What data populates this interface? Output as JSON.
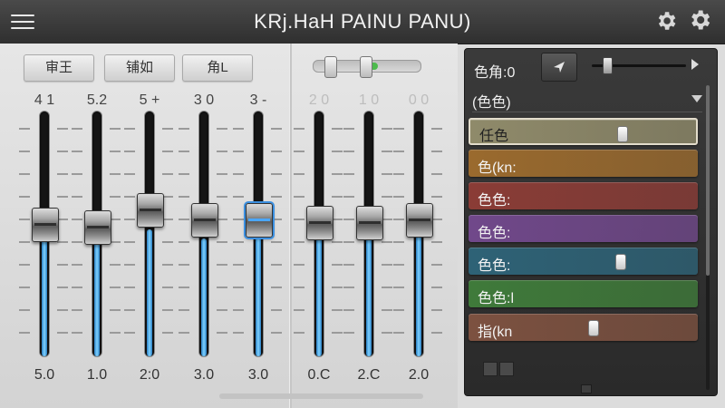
{
  "header": {
    "title": "KRj.HaH PAINU PANU)",
    "icons": [
      "menu-icon",
      "gear-icon",
      "gear-icon"
    ]
  },
  "mixer": {
    "mode_buttons": [
      "审王",
      "铺如",
      "角L"
    ],
    "top_values": [
      "4 1",
      "5.2",
      "5 +",
      "3 0",
      "3 -",
      "2 0",
      "1 0",
      "0 0"
    ],
    "bottom_values": [
      "5.0",
      "1.0",
      "2:0",
      "3.0",
      "3.0",
      "0.C",
      "2.C",
      "2.0"
    ],
    "channels": [
      {
        "level": 0.52,
        "knob": 0.46
      },
      {
        "level": 0.5,
        "knob": 0.47
      },
      {
        "level": 0.52,
        "knob": 0.4
      },
      {
        "level": 0.48,
        "knob": 0.44
      },
      {
        "level": 0.53,
        "knob": 0.44,
        "selected": true
      },
      {
        "level": 0.5,
        "knob": 0.45
      },
      {
        "level": 0.5,
        "knob": 0.45
      },
      {
        "level": 0.5,
        "knob": 0.44
      }
    ],
    "mini_slider": {
      "value": 0.48
    },
    "accent_color": "#3b9be8"
  },
  "panel": {
    "title": "色角:0",
    "slider_value": 0.12,
    "dropdown": "(色色)",
    "swatches": [
      {
        "label": "任色",
        "color": "#8f8a6a",
        "knob": 0.64,
        "active": true
      },
      {
        "label": "色(kn:",
        "color": "#9a6a2e",
        "knob": null
      },
      {
        "label": "色色:",
        "color": "#8a3c36",
        "knob": null
      },
      {
        "label": "色色:",
        "color": "#70488a",
        "knob": null
      },
      {
        "label": "色色:",
        "color": "#2e6276",
        "knob": 0.64
      },
      {
        "label": "色色:l",
        "color": "#3f7a3a",
        "knob": null
      },
      {
        "label": "指(kn",
        "color": "#7c5140",
        "knob": 0.52
      }
    ]
  }
}
